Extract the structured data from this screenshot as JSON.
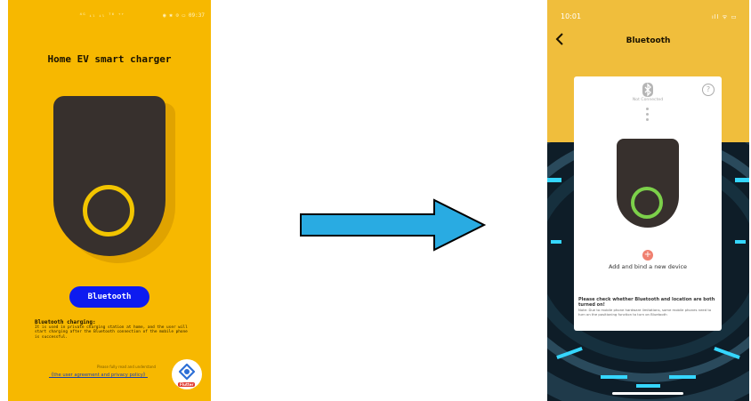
{
  "left_screen": {
    "status_bar": {
      "signal": "⁴ᴳ ᵢₗ ᵢₗ ⁷⁶ ⁺⁺",
      "time": "◉ ✱ ⊙ ▭ 09:37"
    },
    "title": "Home EV smart charger",
    "bluetooth_button": "Bluetooth",
    "description_title": "Bluetooth charging:",
    "description": "It is used in private charging station at home, and the user will start charging after the Bluetooth connection of the mobile phone is successful.",
    "agreement_note": "Please fully read and understand",
    "agreement_link": "《the user agreement and privacy policy》",
    "badge_label": "Flutter",
    "colors": {
      "background": "#F7B800",
      "charger": "#37302d",
      "ring": "#F2C500",
      "button": "#0D1BF0"
    }
  },
  "arrow": {
    "icon": "right-arrow-icon",
    "color": "#29ABE2"
  },
  "right_screen": {
    "status_bar": {
      "time": "10:01",
      "icons": "ıll ᯤ ▭"
    },
    "nav_title": "Bluetooth",
    "connection_status": "Not Connected",
    "add_button": "+",
    "add_label": "Add and bind a new device",
    "check_message": "Please check whether Bluetooth and location are both turned on!",
    "note": "Note: Due to mobile phone hardware limitations, some mobile phones need to turn on the positioning function to turn on Bluetooth",
    "colors": {
      "header": "#F0BE3C",
      "card": "#ffffff",
      "ring": "#7CD04A",
      "add": "#F08070"
    }
  }
}
